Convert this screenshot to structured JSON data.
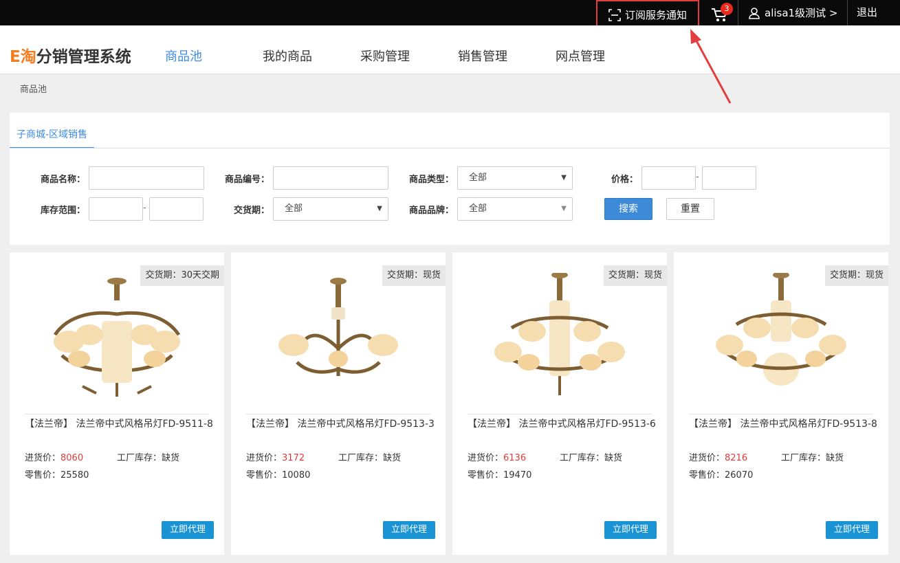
{
  "topbar": {
    "subscribe_label": "订阅服务通知",
    "cart_count": "3",
    "user_label": "alisa1级测试 >",
    "logout_label": "退出"
  },
  "header": {
    "logo_e": "E淘",
    "logo_rest": "分销管理系统",
    "nav": [
      "商品池",
      "我的商品",
      "采购管理",
      "销售管理",
      "网点管理"
    ],
    "active_nav": "商品池"
  },
  "breadcrumb": "商品池",
  "filter": {
    "tab_label": "子商城-区域销售",
    "labels": {
      "name": "商品名称：",
      "code": "商品编号：",
      "type": "商品类型：",
      "price": "价格：",
      "stock_range": "库存范围：",
      "delivery": "交货期：",
      "brand": "商品品牌："
    },
    "type_value": "全部",
    "delivery_value": "全部",
    "brand_value": "全部",
    "range_separator": "-",
    "search_label": "搜索",
    "reset_label": "重置"
  },
  "products": [
    {
      "delivery": "交货期：30天交期",
      "title": "【法兰帝】 法兰帝中式风格吊灯FD-9511-8",
      "purchase_label": "进货价：",
      "purchase_price": "8060",
      "stock_text": "工厂库存：缺货",
      "retail_text": "零售价：25580",
      "action_label": "立即代理"
    },
    {
      "delivery": "交货期：现货",
      "title": "【法兰帝】 法兰帝中式风格吊灯FD-9513-3",
      "purchase_label": "进货价：",
      "purchase_price": "3172",
      "stock_text": "工厂库存：缺货",
      "retail_text": "零售价：10080",
      "action_label": "立即代理"
    },
    {
      "delivery": "交货期：现货",
      "title": "【法兰帝】 法兰帝中式风格吊灯FD-9513-6",
      "purchase_label": "进货价：",
      "purchase_price": "6136",
      "stock_text": "工厂库存：缺货",
      "retail_text": "零售价：19470",
      "action_label": "立即代理"
    },
    {
      "delivery": "交货期：现货",
      "title": "【法兰帝】 法兰帝中式风格吊灯FD-9513-8",
      "purchase_label": "进货价：",
      "purchase_price": "8216",
      "stock_text": "工厂库存：缺货",
      "retail_text": "零售价：26070",
      "action_label": "立即代理"
    }
  ],
  "colors": {
    "accent": "#3d8be2",
    "logo_orange": "#f47d20",
    "price_red": "#e23a3a",
    "action_blue": "#1a93d4",
    "highlight_red": "#e43d3d"
  }
}
